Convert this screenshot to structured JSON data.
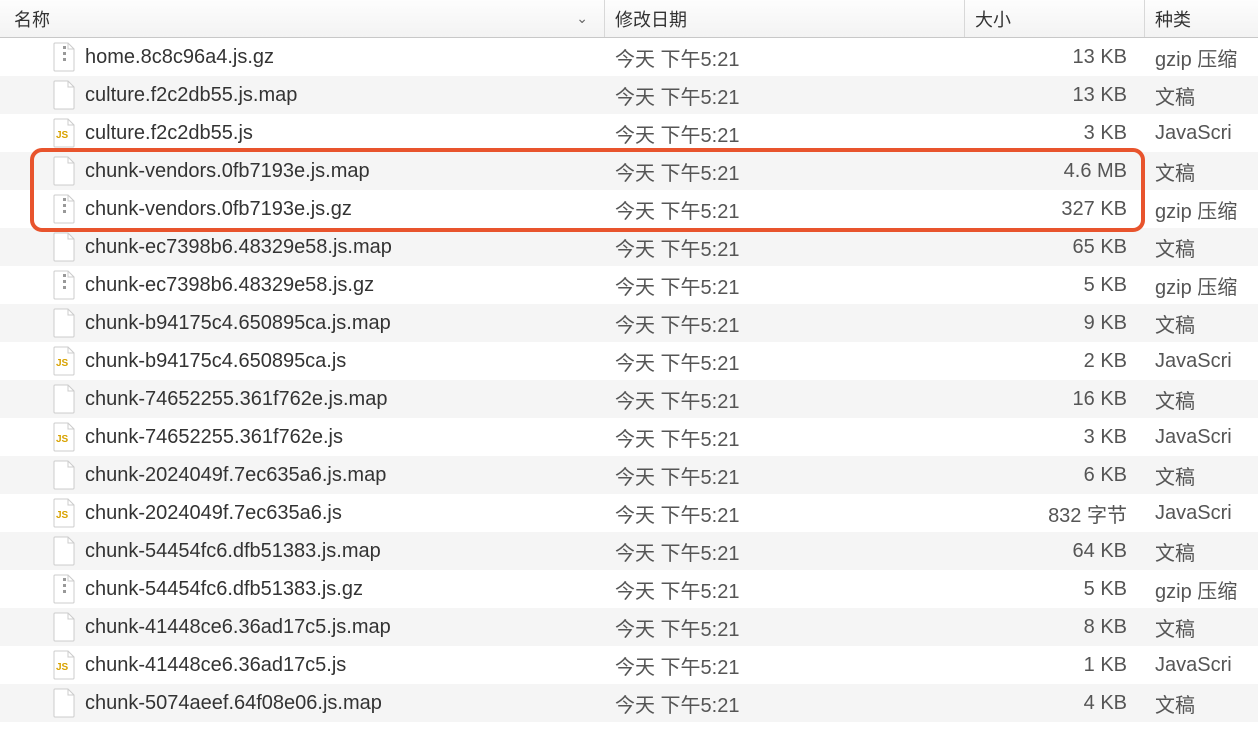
{
  "header": {
    "name": "名称",
    "date": "修改日期",
    "size": "大小",
    "kind": "种类"
  },
  "files": [
    {
      "name": "home.8c8c96a4.js.gz",
      "date": "今天 下午5:21",
      "size": "13 KB",
      "kind": "gzip 压缩",
      "icon": "gz"
    },
    {
      "name": "culture.f2c2db55.js.map",
      "date": "今天 下午5:21",
      "size": "13 KB",
      "kind": "文稿",
      "icon": "doc"
    },
    {
      "name": "culture.f2c2db55.js",
      "date": "今天 下午5:21",
      "size": "3 KB",
      "kind": "JavaScri",
      "icon": "js"
    },
    {
      "name": "chunk-vendors.0fb7193e.js.map",
      "date": "今天 下午5:21",
      "size": "4.6 MB",
      "kind": "文稿",
      "icon": "doc"
    },
    {
      "name": "chunk-vendors.0fb7193e.js.gz",
      "date": "今天 下午5:21",
      "size": "327 KB",
      "kind": "gzip 压缩",
      "icon": "gz"
    },
    {
      "name": "chunk-ec7398b6.48329e58.js.map",
      "date": "今天 下午5:21",
      "size": "65 KB",
      "kind": "文稿",
      "icon": "doc"
    },
    {
      "name": "chunk-ec7398b6.48329e58.js.gz",
      "date": "今天 下午5:21",
      "size": "5 KB",
      "kind": "gzip 压缩",
      "icon": "gz"
    },
    {
      "name": "chunk-b94175c4.650895ca.js.map",
      "date": "今天 下午5:21",
      "size": "9 KB",
      "kind": "文稿",
      "icon": "doc"
    },
    {
      "name": "chunk-b94175c4.650895ca.js",
      "date": "今天 下午5:21",
      "size": "2 KB",
      "kind": "JavaScri",
      "icon": "js"
    },
    {
      "name": "chunk-74652255.361f762e.js.map",
      "date": "今天 下午5:21",
      "size": "16 KB",
      "kind": "文稿",
      "icon": "doc"
    },
    {
      "name": "chunk-74652255.361f762e.js",
      "date": "今天 下午5:21",
      "size": "3 KB",
      "kind": "JavaScri",
      "icon": "js"
    },
    {
      "name": "chunk-2024049f.7ec635a6.js.map",
      "date": "今天 下午5:21",
      "size": "6 KB",
      "kind": "文稿",
      "icon": "doc"
    },
    {
      "name": "chunk-2024049f.7ec635a6.js",
      "date": "今天 下午5:21",
      "size": "832 字节",
      "kind": "JavaScri",
      "icon": "js"
    },
    {
      "name": "chunk-54454fc6.dfb51383.js.map",
      "date": "今天 下午5:21",
      "size": "64 KB",
      "kind": "文稿",
      "icon": "doc"
    },
    {
      "name": "chunk-54454fc6.dfb51383.js.gz",
      "date": "今天 下午5:21",
      "size": "5 KB",
      "kind": "gzip 压缩",
      "icon": "gz"
    },
    {
      "name": "chunk-41448ce6.36ad17c5.js.map",
      "date": "今天 下午5:21",
      "size": "8 KB",
      "kind": "文稿",
      "icon": "doc"
    },
    {
      "name": "chunk-41448ce6.36ad17c5.js",
      "date": "今天 下午5:21",
      "size": "1 KB",
      "kind": "JavaScri",
      "icon": "js"
    },
    {
      "name": "chunk-5074aeef.64f08e06.js.map",
      "date": "今天 下午5:21",
      "size": "4 KB",
      "kind": "文稿",
      "icon": "doc"
    }
  ],
  "highlight": {
    "startIndex": 3,
    "endIndex": 4
  }
}
